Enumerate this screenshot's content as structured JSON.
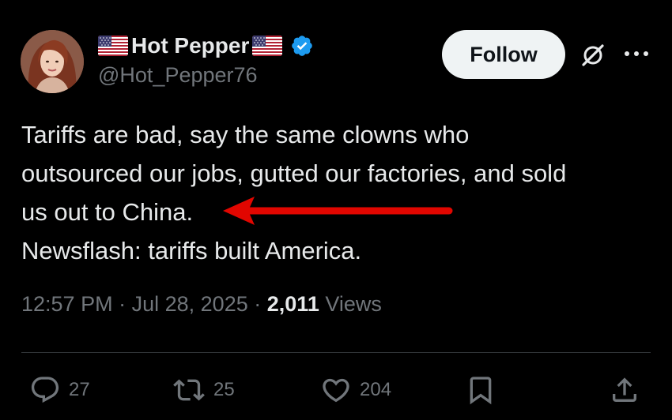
{
  "author": {
    "display_name": "Hot Pepper",
    "handle": "@Hot_Pepper76",
    "verified": true,
    "flag_icon": "us-flag-icon",
    "verified_color": "#1d9bf0"
  },
  "header": {
    "follow_label": "Follow"
  },
  "tweet": {
    "text": "Tariffs are bad, say the same clowns who\noutsourced our jobs, gutted our factories, and sold\nus out to China.\nNewsflash: tariffs built America.",
    "annotation_color": "#e10600"
  },
  "meta": {
    "time": "12:57 PM",
    "separator": "·",
    "date": "Jul 28, 2025",
    "views_count": "2,011",
    "views_label": "Views"
  },
  "actions": {
    "replies": "27",
    "reposts": "25",
    "likes": "204"
  },
  "colors": {
    "background": "#000000",
    "text": "#e7e9ea",
    "secondary": "#71767b",
    "divider": "#2f3336"
  }
}
